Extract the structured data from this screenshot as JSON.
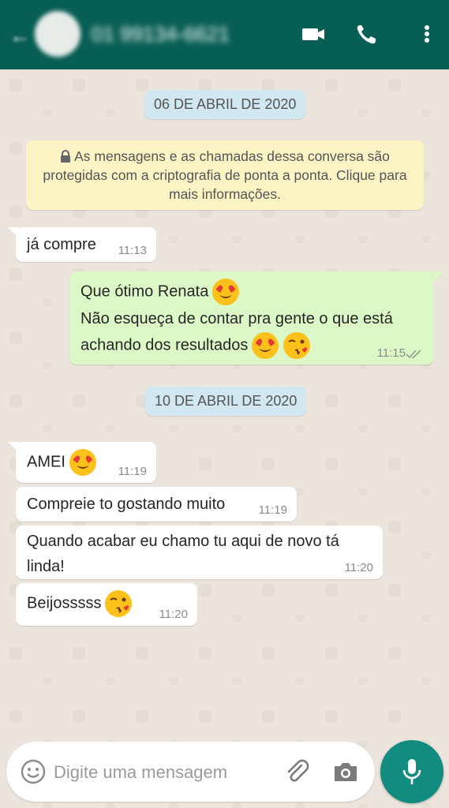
{
  "header": {
    "contact_name": "01 99134-6621",
    "back_icon": "back-arrow-icon",
    "icons": [
      "video-call-icon",
      "phone-call-icon",
      "more-vert-icon"
    ],
    "color": "#075e54"
  },
  "chat": {
    "date1": "06 DE ABRIL DE 2020",
    "encryption_notice": "As mensagens e as chamadas dessa conversa são protegidas com a criptografia de ponta a ponta. Clique para mais informações.",
    "messages": [
      {
        "direction": "in",
        "text": "já compre",
        "time": "11:13"
      },
      {
        "direction": "out",
        "line1": "Que ótimo Renata",
        "line2": "Não esqueça de contar pra gente o que está",
        "line3": "achando dos resultados",
        "time": "11:15",
        "status": "double-check-icon"
      },
      {
        "direction": "in",
        "text": "AMEI",
        "time": "11:19"
      },
      {
        "direction": "in",
        "text": "Compreie to gostando muito",
        "time": "11:19"
      },
      {
        "direction": "in",
        "line1": "Quando acabar eu chamo tu aqui de novo tá",
        "line2": "linda!",
        "time": "11:20"
      },
      {
        "direction": "in",
        "text": "Beijosssss",
        "time": "11:20"
      }
    ],
    "date2": "10 DE ABRIL DE 2020",
    "incoming_bg": "#ffffff",
    "outgoing_bg": "#dcf8c6"
  },
  "input": {
    "placeholder": "Digite uma mensagem",
    "icons": [
      "emoji-icon",
      "attach-icon",
      "camera-icon",
      "mic-icon"
    ],
    "mic_color": "#128c7e"
  }
}
